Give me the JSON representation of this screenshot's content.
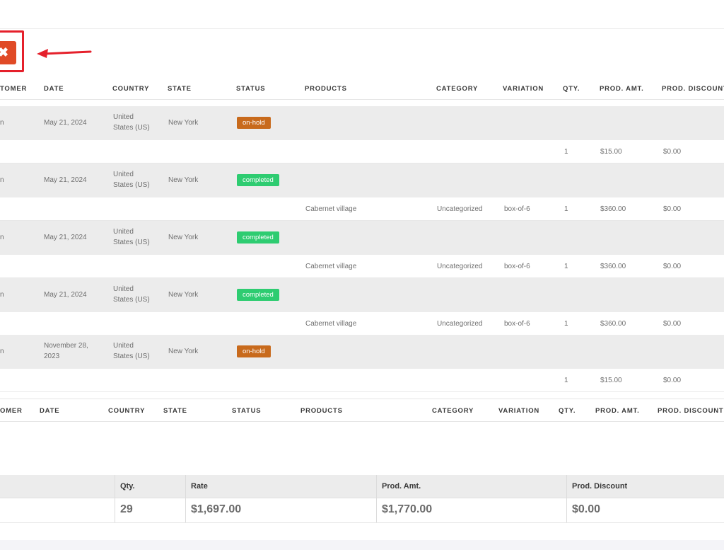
{
  "toolbar": {
    "close_symbol": "✖",
    "accent": "#e04a26",
    "highlight": "#e5202b"
  },
  "table": {
    "columns": [
      "TOMER",
      "DATE",
      "COUNTRY",
      "STATE",
      "STATUS",
      "PRODUCTS",
      "CATEGORY",
      "VARIATION",
      "QTY.",
      "PROD. AMT.",
      "PROD. DISCOUNT"
    ],
    "footer_columns": [
      "OMER",
      "DATE",
      "COUNTRY",
      "STATE",
      "STATUS",
      "PRODUCTS",
      "CATEGORY",
      "VARIATION",
      "QTY.",
      "PROD. AMT.",
      "PROD. DISCOUNT"
    ],
    "orders": [
      {
        "customer_fragment": "n",
        "date_line1": "May 21, 2024",
        "date_line2": "",
        "country_line1": "United",
        "country_line2": "States (US)",
        "state": "New York",
        "status": "on-hold",
        "item": {
          "product": "",
          "category": "",
          "variation": "",
          "qty": "1",
          "amount": "$15.00",
          "discount": "$0.00"
        }
      },
      {
        "customer_fragment": "n",
        "date_line1": "May 21, 2024",
        "date_line2": "",
        "country_line1": "United",
        "country_line2": "States (US)",
        "state": "New York",
        "status": "completed",
        "item": {
          "product": "Cabernet village",
          "category": "Uncategorized",
          "variation": "box-of-6",
          "qty": "1",
          "amount": "$360.00",
          "discount": "$0.00"
        }
      },
      {
        "customer_fragment": "n",
        "date_line1": "May 21, 2024",
        "date_line2": "",
        "country_line1": "United",
        "country_line2": "States (US)",
        "state": "New York",
        "status": "completed",
        "item": {
          "product": "Cabernet village",
          "category": "Uncategorized",
          "variation": "box-of-6",
          "qty": "1",
          "amount": "$360.00",
          "discount": "$0.00"
        }
      },
      {
        "customer_fragment": "n",
        "date_line1": "May 21, 2024",
        "date_line2": "",
        "country_line1": "United",
        "country_line2": "States (US)",
        "state": "New York",
        "status": "completed",
        "item": {
          "product": "Cabernet village",
          "category": "Uncategorized",
          "variation": "box-of-6",
          "qty": "1",
          "amount": "$360.00",
          "discount": "$0.00"
        }
      },
      {
        "customer_fragment": "n",
        "date_line1": "November 28,",
        "date_line2": "2023",
        "country_line1": "United",
        "country_line2": "States (US)",
        "state": "New York",
        "status": "on-hold",
        "item": {
          "product": "",
          "category": "",
          "variation": "",
          "qty": "1",
          "amount": "$15.00",
          "discount": "$0.00"
        }
      }
    ],
    "status_colors": {
      "on-hold": "#c86a1c",
      "completed": "#2ecc71"
    }
  },
  "totals": {
    "headers": {
      "qty": "Qty.",
      "rate": "Rate",
      "amount": "Prod. Amt.",
      "discount": "Prod. Discount"
    },
    "values": {
      "qty": "29",
      "rate": "$1,697.00",
      "amount": "$1,770.00",
      "discount": "$0.00"
    }
  }
}
